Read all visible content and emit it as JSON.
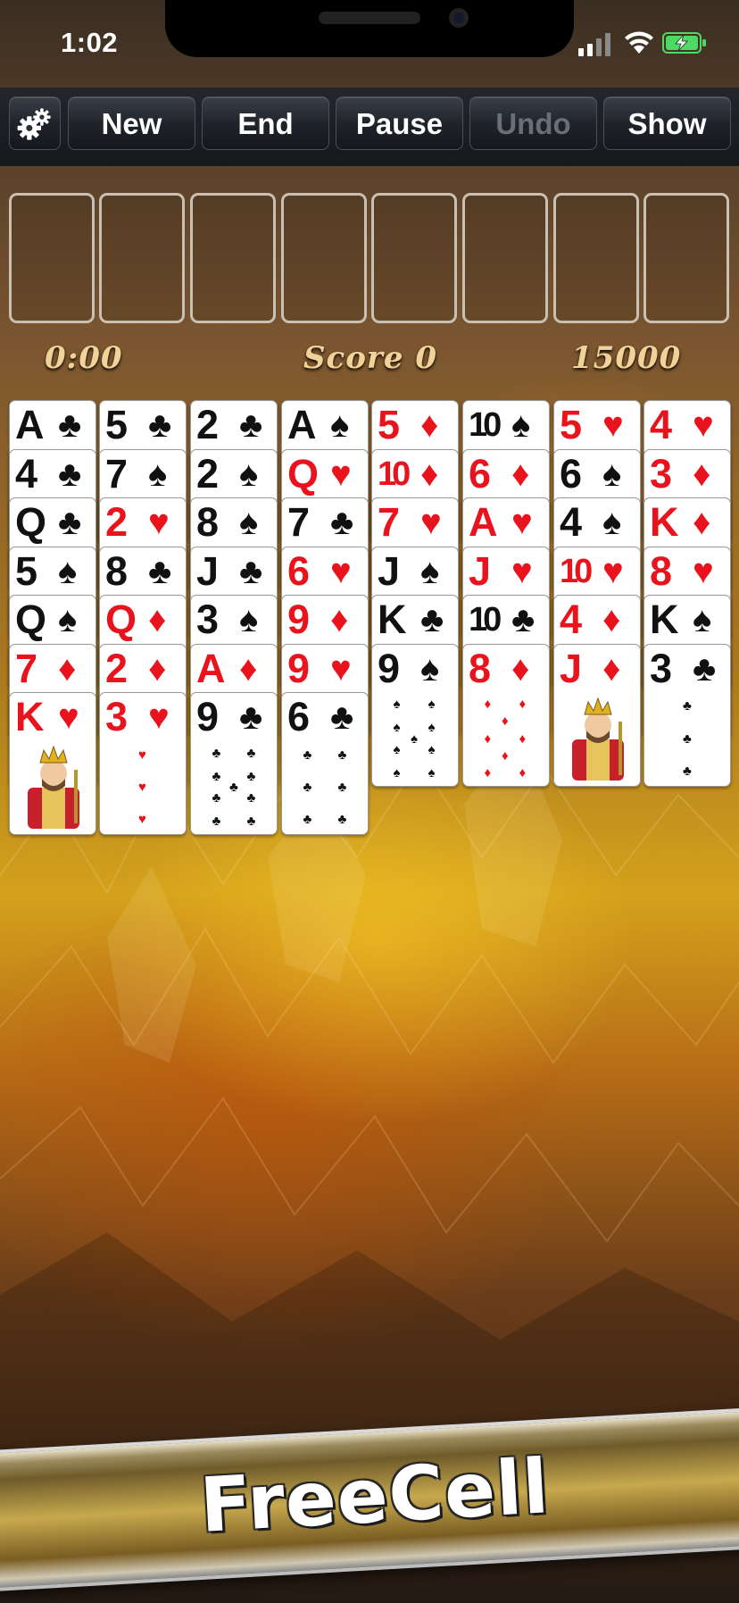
{
  "status": {
    "time": "1:02"
  },
  "toolbar": {
    "settings_icon": "gear-icon",
    "new_label": "New",
    "end_label": "End",
    "pause_label": "Pause",
    "undo_label": "Undo",
    "show_label": "Show"
  },
  "info": {
    "timer": "0:00",
    "score": "Score 0",
    "bonus": "15000"
  },
  "columns": [
    [
      [
        "A",
        "♣"
      ],
      [
        "4",
        "♣"
      ],
      [
        "Q",
        "♣"
      ],
      [
        "5",
        "♠"
      ],
      [
        "Q",
        "♠"
      ],
      [
        "7",
        "♦"
      ],
      [
        "K",
        "♥"
      ]
    ],
    [
      [
        "5",
        "♣"
      ],
      [
        "7",
        "♠"
      ],
      [
        "2",
        "♥"
      ],
      [
        "8",
        "♣"
      ],
      [
        "Q",
        "♦"
      ],
      [
        "2",
        "♦"
      ],
      [
        "3",
        "♥"
      ]
    ],
    [
      [
        "2",
        "♣"
      ],
      [
        "2",
        "♠"
      ],
      [
        "8",
        "♠"
      ],
      [
        "J",
        "♣"
      ],
      [
        "3",
        "♠"
      ],
      [
        "A",
        "♦"
      ],
      [
        "9",
        "♣"
      ]
    ],
    [
      [
        "A",
        "♠"
      ],
      [
        "Q",
        "♥"
      ],
      [
        "7",
        "♣"
      ],
      [
        "6",
        "♥"
      ],
      [
        "9",
        "♦"
      ],
      [
        "9",
        "♥"
      ],
      [
        "6",
        "♣"
      ]
    ],
    [
      [
        "5",
        "♦"
      ],
      [
        "10",
        "♦"
      ],
      [
        "7",
        "♥"
      ],
      [
        "J",
        "♠"
      ],
      [
        "K",
        "♣"
      ],
      [
        "9",
        "♠"
      ]
    ],
    [
      [
        "10",
        "♠"
      ],
      [
        "6",
        "♦"
      ],
      [
        "A",
        "♥"
      ],
      [
        "J",
        "♥"
      ],
      [
        "10",
        "♣"
      ],
      [
        "8",
        "♦"
      ]
    ],
    [
      [
        "5",
        "♥"
      ],
      [
        "6",
        "♠"
      ],
      [
        "4",
        "♠"
      ],
      [
        "10",
        "♥"
      ],
      [
        "4",
        "♦"
      ],
      [
        "J",
        "♦"
      ]
    ],
    [
      [
        "4",
        "♥"
      ],
      [
        "3",
        "♦"
      ],
      [
        "K",
        "♦"
      ],
      [
        "8",
        "♥"
      ],
      [
        "K",
        "♠"
      ],
      [
        "3",
        "♣"
      ]
    ]
  ],
  "colors": {
    "red_suit": "#e8131c",
    "black_suit": "#111111",
    "info_text": "#f1d39a"
  },
  "banner": {
    "title": "FreeCell"
  }
}
